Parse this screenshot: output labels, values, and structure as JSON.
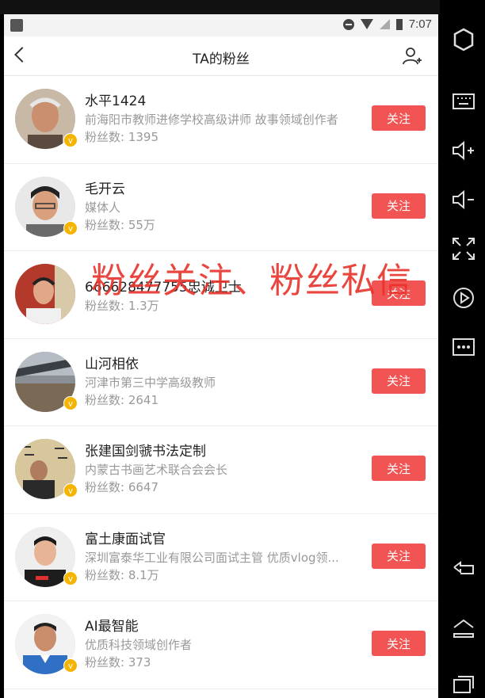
{
  "status_bar": {
    "time": "7:07"
  },
  "nav": {
    "title": "TA的粉丝"
  },
  "overlay": {
    "text": "粉丝关注、粉丝私信"
  },
  "fans": [
    {
      "name": "水平1424",
      "desc": "前海阳市教师进修学校高级讲师 故事领域创作者",
      "fans": "粉丝数: 1395",
      "follow": "关注",
      "verified": true
    },
    {
      "name": "毛开云",
      "desc": "媒体人",
      "fans": "粉丝数: 55万",
      "follow": "关注",
      "verified": true
    },
    {
      "name": "666628477755忠诚卫士",
      "desc": "",
      "fans": "粉丝数: 1.3万",
      "follow": "关注",
      "verified": false
    },
    {
      "name": "山河相依",
      "desc": "河津市第三中学高级教师",
      "fans": "粉丝数: 2641",
      "follow": "关注",
      "verified": true
    },
    {
      "name": "张建国剑虢书法定制",
      "desc": "内蒙古书画艺术联合会会长",
      "fans": "粉丝数: 6647",
      "follow": "关注",
      "verified": true
    },
    {
      "name": "富土康面试官",
      "desc": "深圳富泰华工业有限公司面试主管 优质vlog领...",
      "fans": "粉丝数: 8.1万",
      "follow": "关注",
      "verified": true
    },
    {
      "name": "AI最智能",
      "desc": "优质科技领域创作者",
      "fans": "粉丝数: 373",
      "follow": "关注",
      "verified": true
    }
  ],
  "badge": {
    "verified_label": "v"
  },
  "colors": {
    "follow_button": "#f25454",
    "badge": "#f5b400",
    "overlay": "#e8332c"
  }
}
